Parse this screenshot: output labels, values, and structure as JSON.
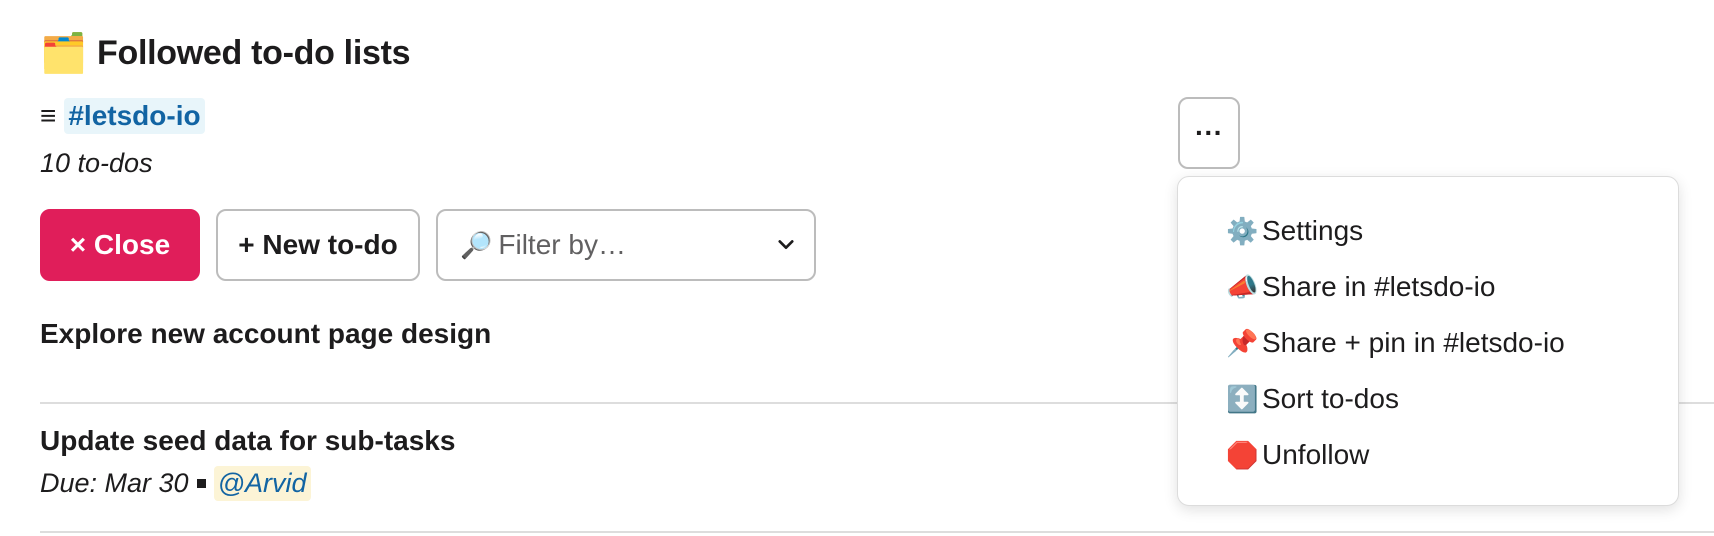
{
  "header": {
    "icon": "🗂️",
    "icon_name": "card-file-box-icon",
    "title": "Followed to-do lists"
  },
  "list": {
    "channel": "#letsdo-io",
    "count_text": "10 to-dos"
  },
  "toolbar": {
    "close_label": "× Close",
    "new_label": "+ New to-do",
    "filter_icon": "🔎",
    "filter_placeholder": "Filter by…"
  },
  "todos": [
    {
      "title": "Explore new account page design"
    },
    {
      "title": "Update seed data for sub-tasks",
      "due": "Due: Mar 30",
      "assignee": "@Arvid"
    }
  ],
  "more_button": {
    "label": "···"
  },
  "menu": {
    "items": [
      {
        "icon": "⚙️",
        "icon_name": "gear-icon",
        "label": "Settings"
      },
      {
        "icon": "📣",
        "icon_name": "megaphone-icon",
        "label": "Share in #letsdo-io"
      },
      {
        "icon": "📌",
        "icon_name": "pushpin-icon",
        "label": "Share + pin in #letsdo-io"
      },
      {
        "icon": "↕️",
        "icon_name": "up-down-arrow-icon",
        "label": "Sort to-dos"
      },
      {
        "icon": "🛑",
        "icon_name": "stop-sign-icon",
        "label": "Unfollow"
      }
    ]
  },
  "colors": {
    "close_button": "#e01e5a",
    "link": "#1264a3",
    "channel_bg": "#e8f5fa",
    "mention_bg": "#fcf4d6"
  }
}
